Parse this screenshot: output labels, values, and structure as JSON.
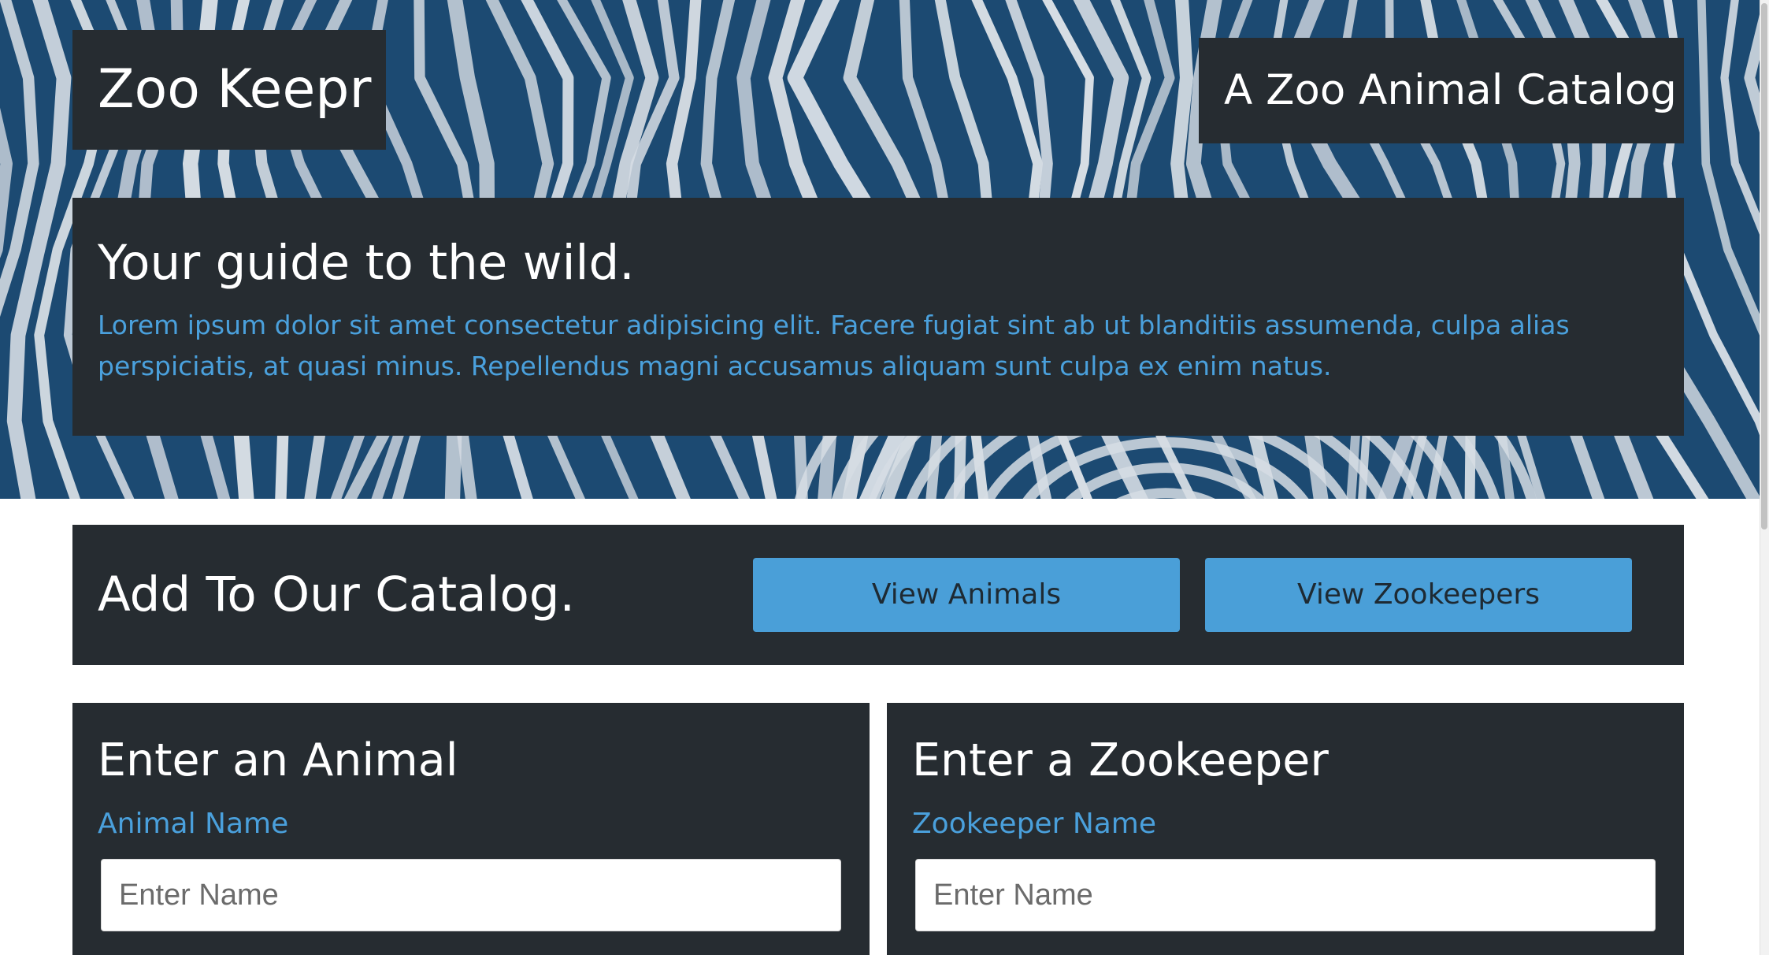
{
  "header": {
    "brand": "Zoo Keepr",
    "tagline": "A Zoo Animal Catalog"
  },
  "intro": {
    "heading": "Your guide to the wild.",
    "text": "Lorem ipsum dolor sit amet consectetur adipisicing elit. Facere fugiat sint ab ut blanditiis assumenda, culpa alias perspiciatis, at quasi minus. Repellendus magni accusamus aliquam sunt culpa ex enim natus."
  },
  "catalog": {
    "heading": "Add To Our Catalog.",
    "view_animals_label": "View Animals",
    "view_zookeepers_label": "View Zookeepers"
  },
  "animal_form": {
    "heading": "Enter an Animal",
    "name_label": "Animal Name",
    "name_placeholder": "Enter Name",
    "name_value": ""
  },
  "zookeeper_form": {
    "heading": "Enter a Zookeeper",
    "name_label": "Zookeeper Name",
    "name_placeholder": "Enter Name",
    "name_value": ""
  },
  "colors": {
    "panel": "#262c31",
    "accent": "#4aa0dc",
    "button": "#4a9fd8",
    "zebra_dark": "#1c4a72",
    "zebra_light": "#d6dde4"
  }
}
